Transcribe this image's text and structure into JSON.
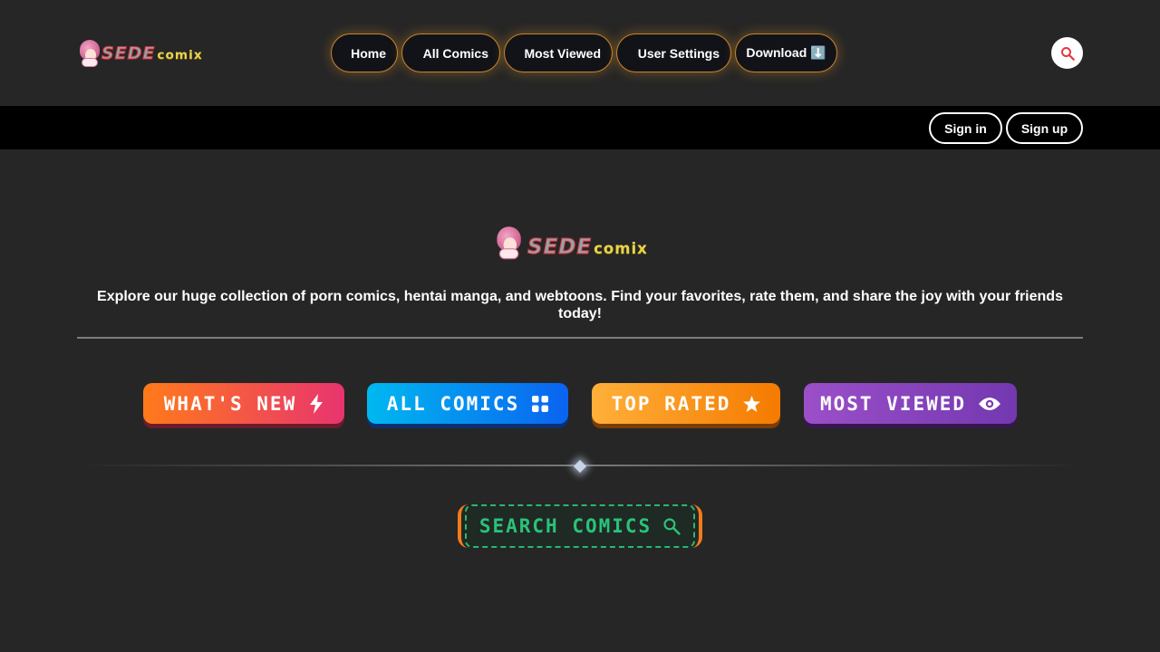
{
  "brand": {
    "logo_text_main": "SEDE",
    "logo_text_sub": "comix"
  },
  "nav": {
    "items": [
      {
        "label": "Home"
      },
      {
        "label": "All Comics"
      },
      {
        "label": "Most Viewed"
      },
      {
        "label": "User Settings"
      },
      {
        "label": "Download ⬇️"
      }
    ],
    "search_icon": "search-icon",
    "accent": "#c9822a"
  },
  "auth": {
    "signin": "Sign in",
    "signup": "Sign up"
  },
  "hero": {
    "tagline": "Explore our huge collection of porn comics, hentai manga, and webtoons. Find your favorites, rate them, and share the joy with your friends today!"
  },
  "categories": [
    {
      "label": "WHAT'S NEW",
      "icon": "lightning-icon",
      "color": "#e8346f"
    },
    {
      "label": "ALL COMICS",
      "icon": "grid-icon",
      "color": "#0a63f0"
    },
    {
      "label": "TOP RATED",
      "icon": "star-icon",
      "color": "#f57a00"
    },
    {
      "label": "MOST VIEWED",
      "icon": "eye-icon",
      "color": "#7338b0"
    }
  ],
  "search_comics": {
    "label": "SEARCH COMICS",
    "icon": "search-icon",
    "color": "#2bc27a"
  }
}
